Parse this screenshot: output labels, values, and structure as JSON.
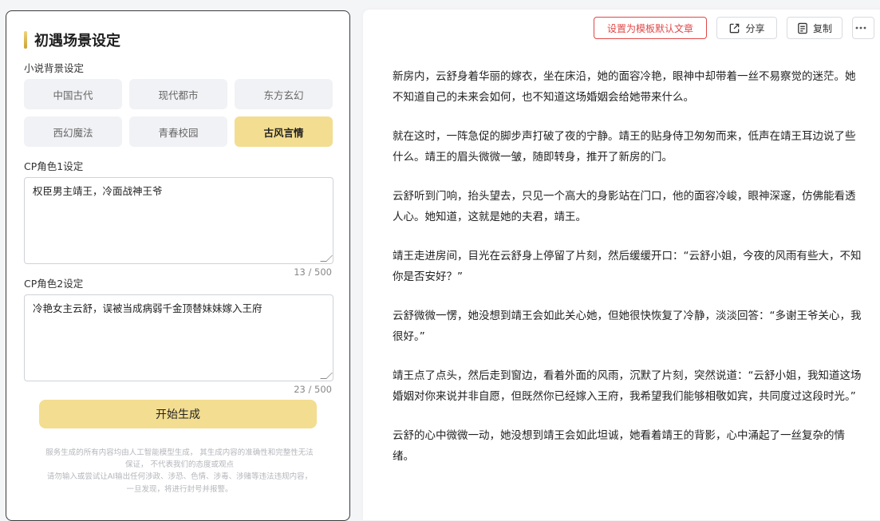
{
  "left": {
    "title": "初遇场景设定",
    "background_label": "小说背景设定",
    "genres": [
      {
        "label": "中国古代",
        "active": false
      },
      {
        "label": "现代都市",
        "active": false
      },
      {
        "label": "东方玄幻",
        "active": false
      },
      {
        "label": "西幻魔法",
        "active": false
      },
      {
        "label": "青春校园",
        "active": false
      },
      {
        "label": "古风言情",
        "active": true
      }
    ],
    "cp1": {
      "label": "CP角色1设定",
      "value": "权臣男主靖王，冷面战神王爷",
      "count": "13 / 500"
    },
    "cp2": {
      "label": "CP角色2设定",
      "value": "冷艳女主云舒，误被当成病弱千金顶替妹妹嫁入王府",
      "count": "23 / 500"
    },
    "generate_label": "开始生成",
    "disclaimer_lines": [
      "服务生成的所有内容均由人工智能模型生成，  其生成内容的准确性和完整性无法",
      "保证，  不代表我们的态度或观点",
      "请勿输入或尝试让AI输出任何涉政、涉恐、色情、涉毒、涉赌等违法违规内容，",
      "一旦发现，将进行封号并报警。"
    ]
  },
  "toolbar": {
    "set_default_label": "设置为模板默认文章",
    "share_label": "分享",
    "copy_label": "复制",
    "more_icon": "more-dots-icon",
    "accent_color": "#e14747"
  },
  "article": {
    "paragraphs": [
      "新房内，云舒身着华丽的嫁衣，坐在床沿，她的面容冷艳，眼神中却带着一丝不易察觉的迷茫。她不知道自己的未来会如何，也不知道这场婚姻会给她带来什么。",
      "就在这时，一阵急促的脚步声打破了夜的宁静。靖王的贴身侍卫匆匆而来，低声在靖王耳边说了些什么。靖王的眉头微微一皱，随即转身，推开了新房的门。",
      "云舒听到门响，抬头望去，只见一个高大的身影站在门口，他的面容冷峻，眼神深邃，仿佛能看透人心。她知道，这就是她的夫君，靖王。",
      "靖王走进房间，目光在云舒身上停留了片刻，然后缓缓开口：“云舒小姐，今夜的风雨有些大，不知你是否安好？”",
      "云舒微微一愣，她没想到靖王会如此关心她，但她很快恢复了冷静，淡淡回答：“多谢王爷关心，我很好。”",
      "靖王点了点头，然后走到窗边，看着外面的风雨，沉默了片刻，突然说道：“云舒小姐，我知道这场婚姻对你来说并非自愿，但既然你已经嫁入王府，我希望我们能够相敬如宾，共同度过这段时光。”",
      "云舒的心中微微一动，她没想到靖王会如此坦诚，她看着靖王的背影，心中涌起了一丝复杂的情绪。"
    ]
  }
}
